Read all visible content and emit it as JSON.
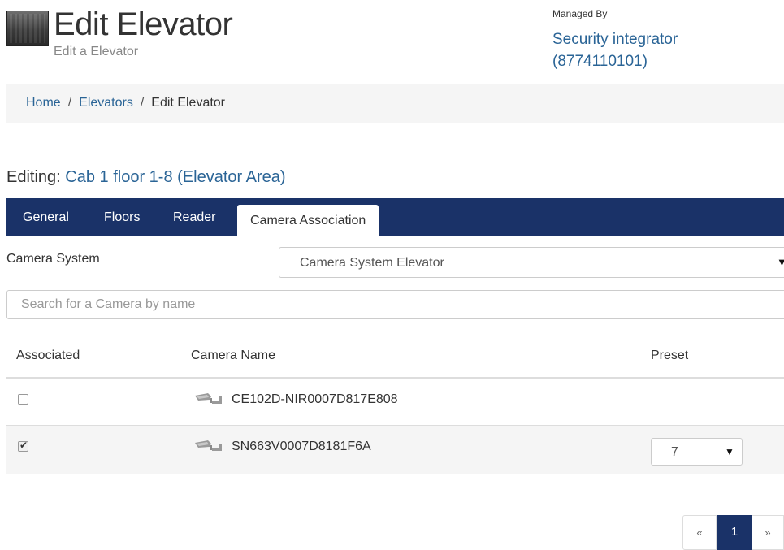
{
  "header": {
    "title": "Edit Elevator",
    "subtitle": "Edit a Elevator",
    "managed_by_label": "Managed By",
    "managed_by_name": "Security integrator",
    "managed_by_phone": "(8774110101)"
  },
  "breadcrumb": {
    "home": "Home",
    "separator": "/",
    "elevators": "Elevators",
    "current": "Edit Elevator"
  },
  "editing": {
    "prefix": "Editing:",
    "name": "Cab 1 floor 1-8 (Elevator Area)"
  },
  "tabs": {
    "general": "General",
    "floors": "Floors",
    "reader": "Reader",
    "camera_association": "Camera Association",
    "active": "Camera Association"
  },
  "camera_system": {
    "label": "Camera System",
    "selected": "Camera System Elevator",
    "arrow": "▼"
  },
  "search": {
    "placeholder": "Search for a Camera by name",
    "value": ""
  },
  "table": {
    "headers": {
      "associated": "Associated",
      "camera_name": "Camera Name",
      "preset": "Preset"
    },
    "rows": [
      {
        "associated": false,
        "camera_name": "CE102D-NIR0007D817E808",
        "preset": ""
      },
      {
        "associated": true,
        "camera_name": "SN663V0007D8181F6A",
        "preset": "7"
      }
    ],
    "preset_arrow": "▼"
  },
  "pagination": {
    "prev": "«",
    "current": "1",
    "next": "»"
  },
  "colors": {
    "nav_bg": "#1a3268",
    "link": "#2a6496",
    "breadcrumb_bg": "#f5f5f5"
  }
}
